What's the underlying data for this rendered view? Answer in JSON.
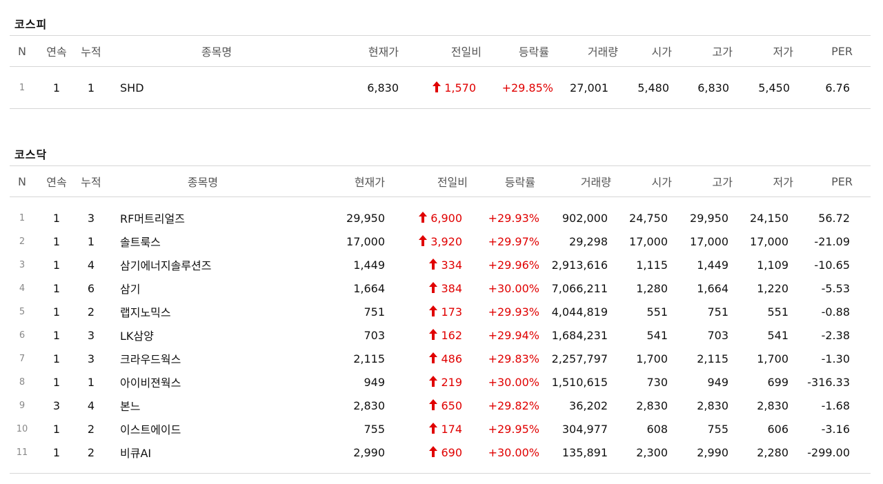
{
  "headers": {
    "n": "N",
    "consecutive": "연속",
    "accumulated": "누적",
    "name": "종목명",
    "price": "현재가",
    "change": "전일비",
    "rate": "등락률",
    "volume": "거래량",
    "open": "시가",
    "high": "고가",
    "low": "저가",
    "per": "PER"
  },
  "colors": {
    "up": "#e00000",
    "border": "#d6d6d6"
  },
  "icons": {
    "up_arrow": "arrow-up-icon"
  },
  "kospi": {
    "title": "코스피",
    "rows": [
      {
        "n": "1",
        "consecutive": "1",
        "accumulated": "1",
        "name": "SHD",
        "price": "6,830",
        "change": "1,570",
        "rate": "+29.85%",
        "volume": "27,001",
        "open": "5,480",
        "high": "6,830",
        "low": "5,450",
        "per": "6.76"
      }
    ]
  },
  "kosdaq": {
    "title": "코스닥",
    "rows": [
      {
        "n": "1",
        "consecutive": "1",
        "accumulated": "3",
        "name": "RF머트리얼즈",
        "price": "29,950",
        "change": "6,900",
        "rate": "+29.93%",
        "volume": "902,000",
        "open": "24,750",
        "high": "29,950",
        "low": "24,150",
        "per": "56.72"
      },
      {
        "n": "2",
        "consecutive": "1",
        "accumulated": "1",
        "name": "솔트룩스",
        "price": "17,000",
        "change": "3,920",
        "rate": "+29.97%",
        "volume": "29,298",
        "open": "17,000",
        "high": "17,000",
        "low": "17,000",
        "per": "-21.09"
      },
      {
        "n": "3",
        "consecutive": "1",
        "accumulated": "4",
        "name": "삼기에너지솔루션즈",
        "price": "1,449",
        "change": "334",
        "rate": "+29.96%",
        "volume": "2,913,616",
        "open": "1,115",
        "high": "1,449",
        "low": "1,109",
        "per": "-10.65"
      },
      {
        "n": "4",
        "consecutive": "1",
        "accumulated": "6",
        "name": "삼기",
        "price": "1,664",
        "change": "384",
        "rate": "+30.00%",
        "volume": "7,066,211",
        "open": "1,280",
        "high": "1,664",
        "low": "1,220",
        "per": "-5.53"
      },
      {
        "n": "5",
        "consecutive": "1",
        "accumulated": "2",
        "name": "랩지노믹스",
        "price": "751",
        "change": "173",
        "rate": "+29.93%",
        "volume": "4,044,819",
        "open": "551",
        "high": "751",
        "low": "551",
        "per": "-0.88"
      },
      {
        "n": "6",
        "consecutive": "1",
        "accumulated": "3",
        "name": "LK삼양",
        "price": "703",
        "change": "162",
        "rate": "+29.94%",
        "volume": "1,684,231",
        "open": "541",
        "high": "703",
        "low": "541",
        "per": "-2.38"
      },
      {
        "n": "7",
        "consecutive": "1",
        "accumulated": "3",
        "name": "크라우드웍스",
        "price": "2,115",
        "change": "486",
        "rate": "+29.83%",
        "volume": "2,257,797",
        "open": "1,700",
        "high": "2,115",
        "low": "1,700",
        "per": "-1.30"
      },
      {
        "n": "8",
        "consecutive": "1",
        "accumulated": "1",
        "name": "아이비젼웍스",
        "price": "949",
        "change": "219",
        "rate": "+30.00%",
        "volume": "1,510,615",
        "open": "730",
        "high": "949",
        "low": "699",
        "per": "-316.33"
      },
      {
        "n": "9",
        "consecutive": "3",
        "accumulated": "4",
        "name": "본느",
        "price": "2,830",
        "change": "650",
        "rate": "+29.82%",
        "volume": "36,202",
        "open": "2,830",
        "high": "2,830",
        "low": "2,830",
        "per": "-1.68"
      },
      {
        "n": "10",
        "consecutive": "1",
        "accumulated": "2",
        "name": "이스트에이드",
        "price": "755",
        "change": "174",
        "rate": "+29.95%",
        "volume": "304,977",
        "open": "608",
        "high": "755",
        "low": "606",
        "per": "-3.16"
      },
      {
        "n": "11",
        "consecutive": "1",
        "accumulated": "2",
        "name": "비큐AI",
        "price": "2,990",
        "change": "690",
        "rate": "+30.00%",
        "volume": "135,891",
        "open": "2,300",
        "high": "2,990",
        "low": "2,280",
        "per": "-299.00"
      }
    ]
  }
}
